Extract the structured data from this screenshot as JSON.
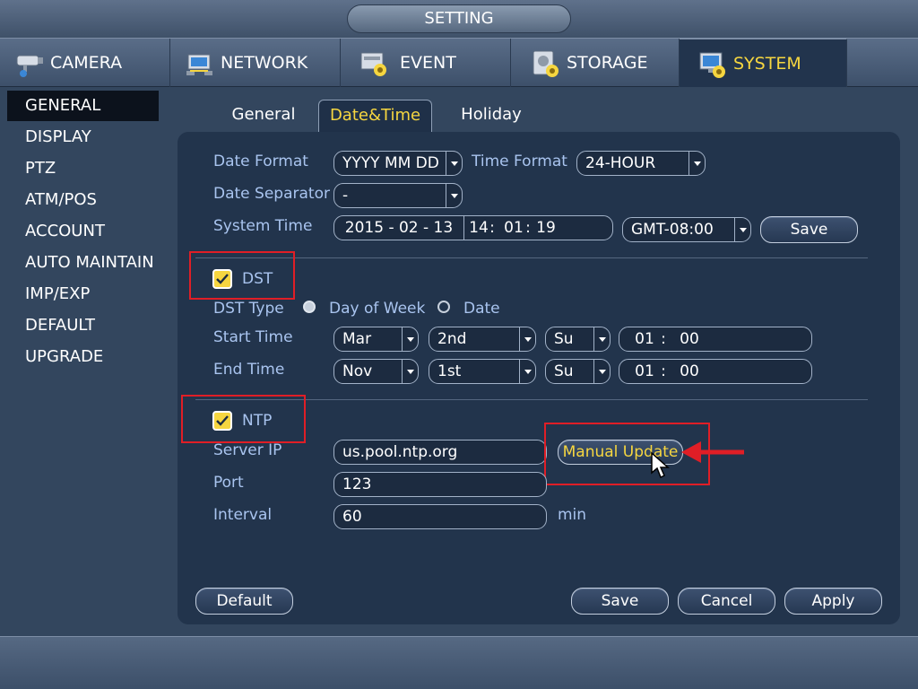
{
  "window": {
    "title": "SETTING"
  },
  "top_tabs": [
    {
      "label": "CAMERA",
      "icon": "camera-icon"
    },
    {
      "label": "NETWORK",
      "icon": "network-icon"
    },
    {
      "label": "EVENT",
      "icon": "event-icon"
    },
    {
      "label": "STORAGE",
      "icon": "storage-icon"
    },
    {
      "label": "SYSTEM",
      "icon": "system-icon",
      "active": true
    }
  ],
  "sidebar": {
    "items": [
      {
        "label": "GENERAL",
        "active": true
      },
      {
        "label": "DISPLAY"
      },
      {
        "label": "PTZ"
      },
      {
        "label": "ATM/POS"
      },
      {
        "label": "ACCOUNT"
      },
      {
        "label": "AUTO MAINTAIN"
      },
      {
        "label": "IMP/EXP"
      },
      {
        "label": "DEFAULT"
      },
      {
        "label": "UPGRADE"
      }
    ]
  },
  "sub_tabs": [
    {
      "label": "General"
    },
    {
      "label": "Date&Time",
      "active": true
    },
    {
      "label": "Holiday"
    }
  ],
  "datetime": {
    "date_format_label": "Date Format",
    "date_format_value": "YYYY MM DD",
    "time_format_label": "Time Format",
    "time_format_value": "24-HOUR",
    "date_separator_label": "Date Separator",
    "date_separator_value": "-",
    "system_time_label": "System Time",
    "system_date": "2015 - 02 - 13",
    "system_hour": "14",
    "system_minute": "01",
    "system_second": "19",
    "time_colon": ":",
    "timezone_value": "GMT-08:00",
    "save_label": "Save"
  },
  "dst": {
    "enable_label": "DST",
    "enabled": true,
    "type_label": "DST Type",
    "type_option_week": "Day of Week",
    "type_option_date": "Date",
    "selected_type": "Day of Week",
    "start_label": "Start Time",
    "start_month": "Mar",
    "start_week": "2nd",
    "start_day": "Su",
    "start_hour": "01",
    "start_minute": "00",
    "end_label": "End Time",
    "end_month": "Nov",
    "end_week": "1st",
    "end_day": "Su",
    "end_hour": "01",
    "end_minute": "00"
  },
  "ntp": {
    "enable_label": "NTP",
    "enabled": true,
    "server_label": "Server IP",
    "server_value": "us.pool.ntp.org",
    "manual_update_label": "Manual Update",
    "port_label": "Port",
    "port_value": "123",
    "interval_label": "Interval",
    "interval_value": "60",
    "interval_unit": "min"
  },
  "footer": {
    "default_label": "Default",
    "save_label": "Save",
    "cancel_label": "Cancel",
    "apply_label": "Apply"
  },
  "colors": {
    "active_text": "#f6d640",
    "label_text": "#a9c4ef",
    "panel_bg": "#22344c",
    "page_bg": "#33465e",
    "annotation_red": "#e01e26"
  }
}
